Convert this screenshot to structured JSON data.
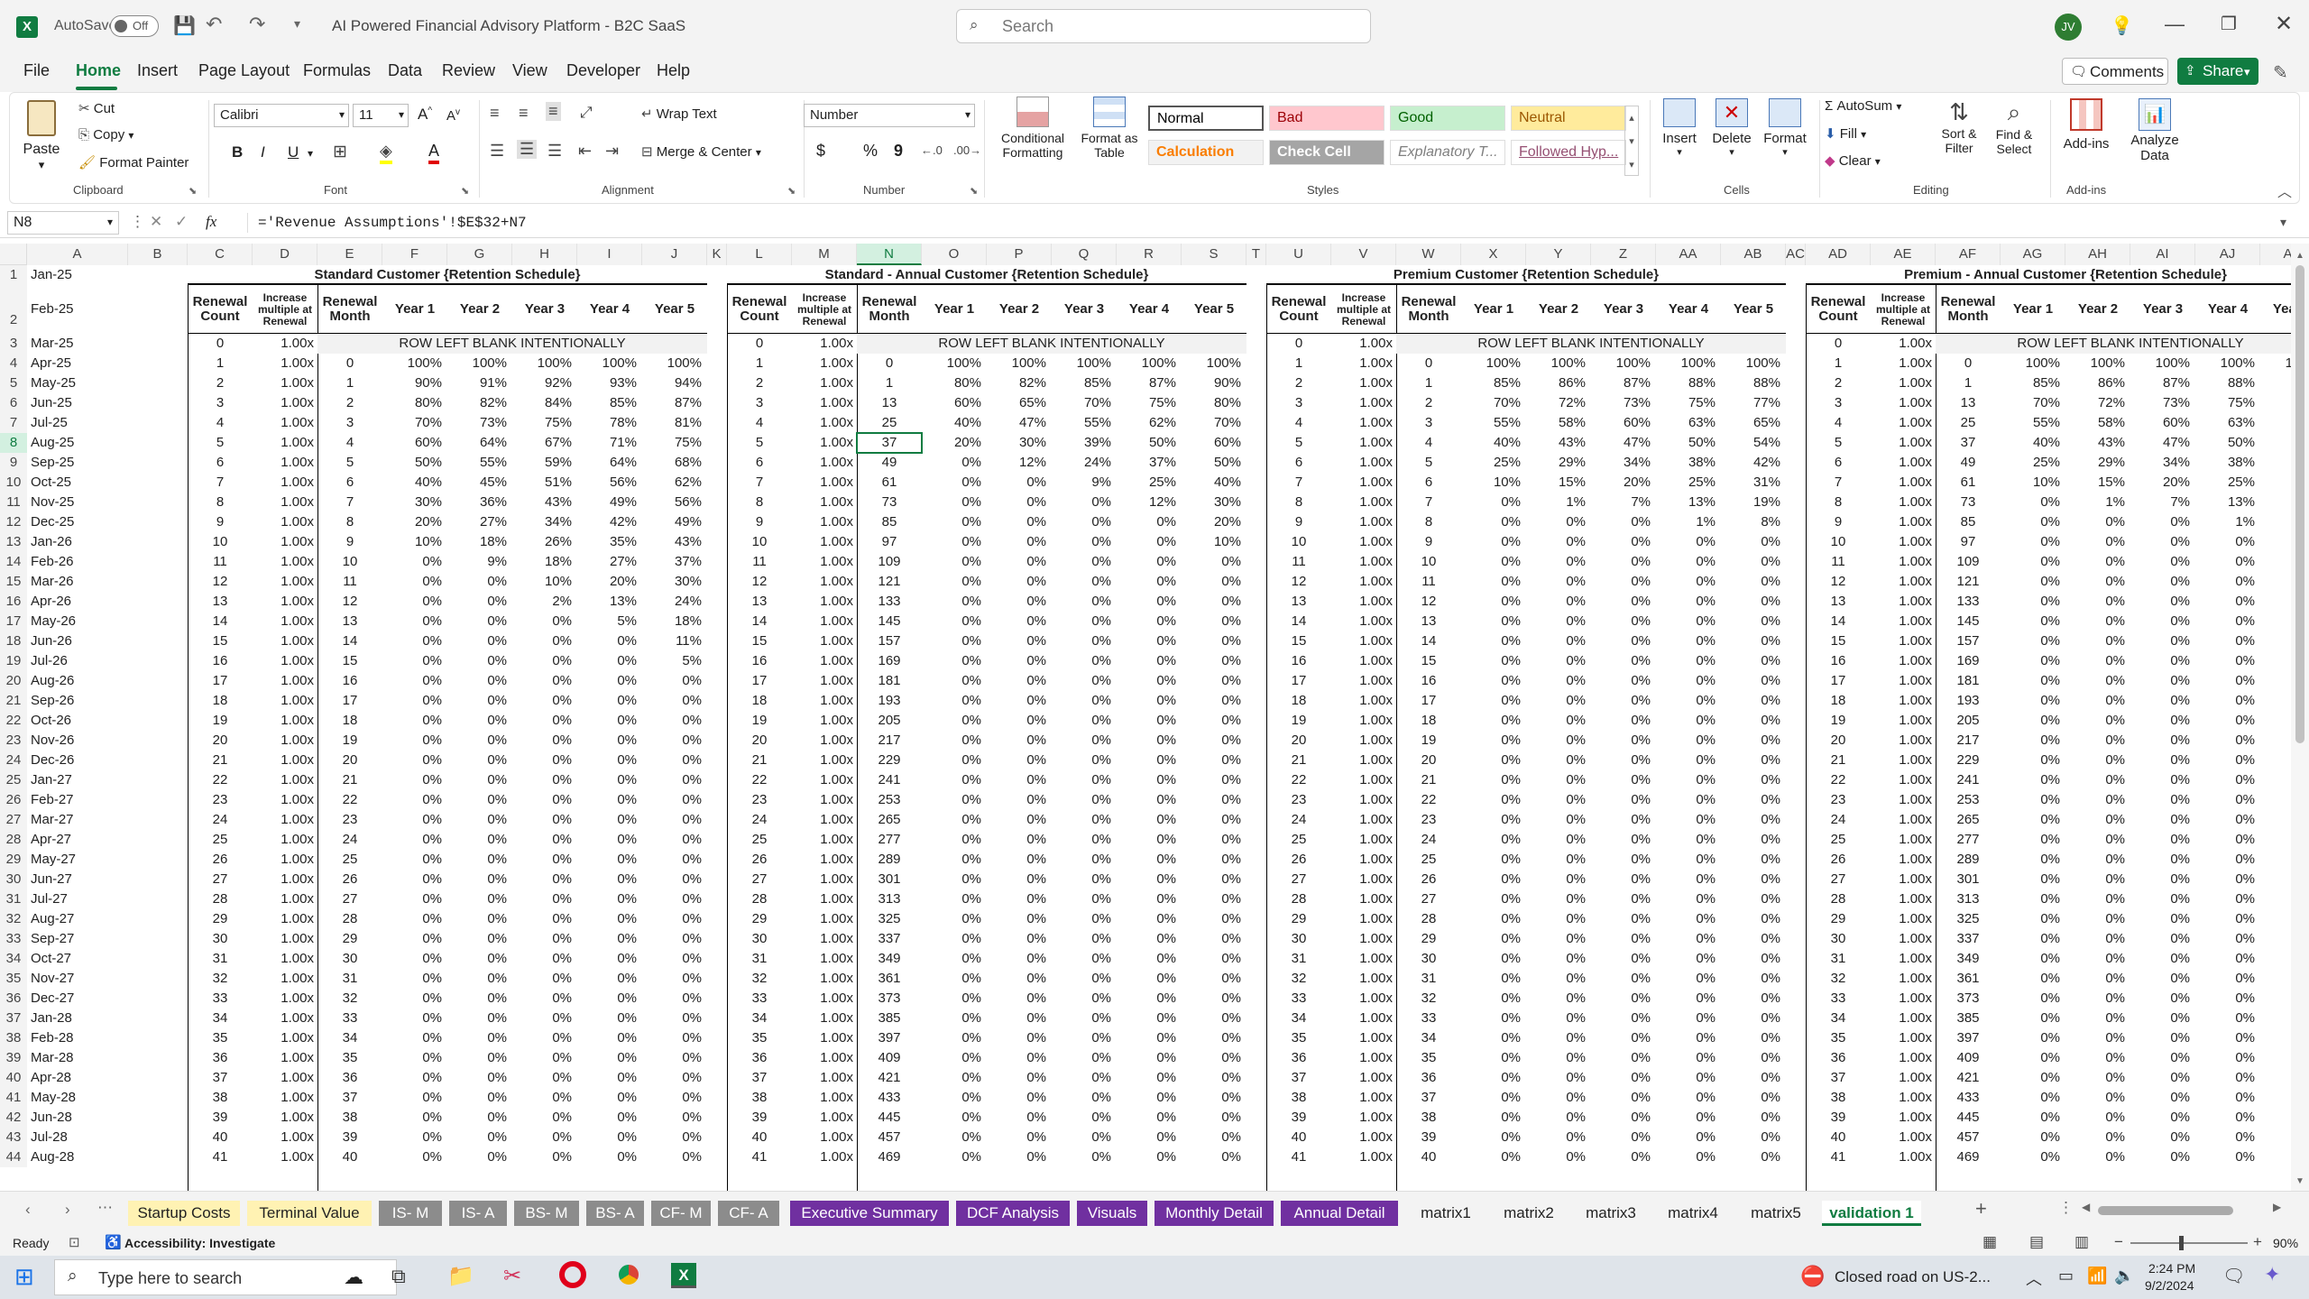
{
  "titlebar": {
    "autosave_label": "AutoSave",
    "autosave_state": "Off",
    "doc_title": "AI Powered Financial Advisory Platform - B2C SaaS",
    "search_placeholder": "Search",
    "user_initials": "JV"
  },
  "menu": {
    "tabs": [
      "File",
      "Home",
      "Insert",
      "Page Layout",
      "Formulas",
      "Data",
      "Review",
      "View",
      "Developer",
      "Help"
    ],
    "active": "Home",
    "comments": "Comments",
    "share": "Share"
  },
  "ribbon": {
    "clipboard": {
      "paste": "Paste",
      "cut": "Cut",
      "copy": "Copy",
      "format_painter": "Format Painter",
      "label": "Clipboard"
    },
    "font": {
      "name": "Calibri",
      "size": "11",
      "label": "Font",
      "bold": "B",
      "italic": "I",
      "underline": "U"
    },
    "alignment": {
      "wrap": "Wrap Text",
      "merge": "Merge & Center",
      "label": "Alignment"
    },
    "number": {
      "format": "Number",
      "label": "Number",
      "currency": "$",
      "percent": "%",
      "comma": "9"
    },
    "styles": {
      "conditional": "Conditional Formatting",
      "format_table": "Format as Table",
      "cells": [
        {
          "name": "Normal",
          "bg": "#ffffff",
          "fg": "#000000"
        },
        {
          "name": "Bad",
          "bg": "#ffc7ce",
          "fg": "#9c0006"
        },
        {
          "name": "Good",
          "bg": "#c6efce",
          "fg": "#006100"
        },
        {
          "name": "Neutral",
          "bg": "#ffeb9c",
          "fg": "#9c5700"
        },
        {
          "name": "Calculation",
          "bg": "#f2f2f2",
          "fg": "#fa7d00"
        },
        {
          "name": "Check Cell",
          "bg": "#a5a5a5",
          "fg": "#ffffff"
        },
        {
          "name": "Explanatory T...",
          "bg": "#ffffff",
          "fg": "#7f7f7f"
        },
        {
          "name": "Followed Hyp...",
          "bg": "#ffffff",
          "fg": "#954f72"
        }
      ],
      "label": "Styles"
    },
    "cells": {
      "insert": "Insert",
      "delete": "Delete",
      "format": "Format",
      "label": "Cells"
    },
    "editing": {
      "autosum": "AutoSum",
      "fill": "Fill",
      "clear": "Clear",
      "sort": "Sort & Filter",
      "find": "Find & Select",
      "label": "Editing"
    },
    "addins": {
      "addins": "Add-ins",
      "analyze": "Analyze Data",
      "label": "Add-ins"
    }
  },
  "formula_bar": {
    "name_box": "N8",
    "fx": "fx",
    "formula": "='Revenue Assumptions'!$E$32+N7"
  },
  "sheet": {
    "columns": [
      "A",
      "B",
      "C",
      "D",
      "E",
      "F",
      "G",
      "H",
      "I",
      "J",
      "K",
      "L",
      "M",
      "N",
      "O",
      "P",
      "Q",
      "R",
      "S",
      "T",
      "U",
      "V",
      "W",
      "X",
      "Y",
      "Z",
      "AA",
      "AB",
      "AC",
      "AD",
      "AE",
      "AF",
      "AG",
      "AH",
      "AI",
      "AJ",
      "AK"
    ],
    "rows": [
      1,
      2,
      3,
      4,
      5,
      6,
      7,
      8,
      9,
      10,
      11,
      12,
      13,
      14,
      15,
      16,
      17,
      18,
      19,
      20,
      21,
      22,
      23,
      24,
      25,
      26,
      27,
      28,
      29,
      30,
      31,
      32,
      33,
      34,
      35,
      36,
      37,
      38,
      39,
      40,
      41,
      42,
      43,
      44
    ],
    "dates": [
      "Jan-25",
      "Feb-25",
      "Mar-25",
      "Apr-25",
      "May-25",
      "Jun-25",
      "Jul-25",
      "Aug-25",
      "Sep-25",
      "Oct-25",
      "Nov-25",
      "Dec-25",
      "Jan-26",
      "Feb-26",
      "Mar-26",
      "Apr-26",
      "May-26",
      "Jun-26",
      "Jul-26",
      "Aug-26",
      "Sep-26",
      "Oct-26",
      "Nov-26",
      "Dec-26",
      "Jan-27",
      "Feb-27",
      "Mar-27",
      "Apr-27",
      "May-27",
      "Jun-27",
      "Jul-27",
      "Aug-27",
      "Sep-27",
      "Oct-27",
      "Nov-27",
      "Dec-27",
      "Jan-28",
      "Feb-28",
      "Mar-28",
      "Apr-28",
      "May-28",
      "Jun-28",
      "Jul-28",
      "Aug-28"
    ],
    "blank_text": "ROW LEFT BLANK INTENTIONALLY",
    "sub_headers": [
      "Renewal Count",
      "Increase multiple at Renewal",
      "Renewal Month",
      "Year 1",
      "Year 2",
      "Year 3",
      "Year 4",
      "Year 5"
    ],
    "blocks": [
      {
        "title": "Standard Customer {Retention Schedule}",
        "months": "seq",
        "pcts": [
          [
            100,
            100,
            100,
            100,
            100
          ],
          [
            90,
            91,
            92,
            93,
            94
          ],
          [
            80,
            82,
            84,
            85,
            87
          ],
          [
            70,
            73,
            75,
            78,
            81
          ],
          [
            60,
            64,
            67,
            71,
            75
          ],
          [
            50,
            55,
            59,
            64,
            68
          ],
          [
            40,
            45,
            51,
            56,
            62
          ],
          [
            30,
            36,
            43,
            49,
            56
          ],
          [
            20,
            27,
            34,
            42,
            49
          ],
          [
            10,
            18,
            26,
            35,
            43
          ],
          [
            0,
            9,
            18,
            27,
            37
          ],
          [
            0,
            0,
            10,
            20,
            30
          ],
          [
            0,
            0,
            2,
            13,
            24
          ],
          [
            0,
            0,
            0,
            5,
            18
          ],
          [
            0,
            0,
            0,
            0,
            11
          ],
          [
            0,
            0,
            0,
            0,
            5
          ]
        ]
      },
      {
        "title": "Standard - Annual Customer {Retention Schedule}",
        "months": "annual",
        "pcts": [
          [
            100,
            100,
            100,
            100,
            100
          ],
          [
            80,
            82,
            85,
            87,
            90
          ],
          [
            60,
            65,
            70,
            75,
            80
          ],
          [
            40,
            47,
            55,
            62,
            70
          ],
          [
            20,
            30,
            39,
            50,
            60
          ],
          [
            0,
            12,
            24,
            37,
            50
          ],
          [
            0,
            0,
            9,
            25,
            40
          ],
          [
            0,
            0,
            0,
            12,
            30
          ],
          [
            0,
            0,
            0,
            0,
            20
          ],
          [
            0,
            0,
            0,
            0,
            10
          ]
        ]
      },
      {
        "title": "Premium Customer {Retention Schedule}",
        "months": "seq",
        "pcts": [
          [
            100,
            100,
            100,
            100,
            100
          ],
          [
            85,
            86,
            87,
            88,
            88
          ],
          [
            70,
            72,
            73,
            75,
            77
          ],
          [
            55,
            58,
            60,
            63,
            65
          ],
          [
            40,
            43,
            47,
            50,
            54
          ],
          [
            25,
            29,
            34,
            38,
            42
          ],
          [
            10,
            15,
            20,
            25,
            31
          ],
          [
            0,
            1,
            7,
            13,
            19
          ],
          [
            0,
            0,
            0,
            1,
            8
          ]
        ]
      },
      {
        "title": "Premium - Annual Customer {Retention Schedule}",
        "months": "annual",
        "pcts": [
          [
            100,
            100,
            100,
            100,
            100
          ],
          [
            85,
            86,
            87,
            88,
            88
          ],
          [
            70,
            72,
            73,
            75,
            77
          ],
          [
            55,
            58,
            60,
            63,
            65
          ],
          [
            40,
            43,
            47,
            50,
            54
          ],
          [
            25,
            29,
            34,
            38,
            42
          ],
          [
            10,
            15,
            20,
            25,
            31
          ],
          [
            0,
            1,
            7,
            13,
            19
          ],
          [
            0,
            0,
            0,
            1,
            8
          ]
        ]
      }
    ],
    "multiple": "1.00x"
  },
  "tabs": [
    {
      "name": "Startup Costs",
      "color": "#fff2b3",
      "fg": "#222"
    },
    {
      "name": "Terminal Value",
      "color": "#fff2b3",
      "fg": "#222"
    },
    {
      "name": "IS- M",
      "color": "#8c8c8c",
      "fg": "#ffffff"
    },
    {
      "name": "IS- A",
      "color": "#8c8c8c",
      "fg": "#ffffff"
    },
    {
      "name": "BS- M",
      "color": "#8c8c8c",
      "fg": "#ffffff"
    },
    {
      "name": "BS- A",
      "color": "#8c8c8c",
      "fg": "#ffffff"
    },
    {
      "name": "CF- M",
      "color": "#8c8c8c",
      "fg": "#ffffff"
    },
    {
      "name": "CF- A",
      "color": "#8c8c8c",
      "fg": "#ffffff"
    },
    {
      "name": "Executive Summary",
      "color": "#7030a0",
      "fg": "#ffffff"
    },
    {
      "name": "DCF Analysis",
      "color": "#7030a0",
      "fg": "#ffffff"
    },
    {
      "name": "Visuals",
      "color": "#7030a0",
      "fg": "#ffffff"
    },
    {
      "name": "Monthly Detail",
      "color": "#7030a0",
      "fg": "#ffffff"
    },
    {
      "name": "Annual Detail",
      "color": "#7030a0",
      "fg": "#ffffff"
    },
    {
      "name": "matrix1",
      "color": "",
      "fg": "#222"
    },
    {
      "name": "matrix2",
      "color": "",
      "fg": "#222"
    },
    {
      "name": "matrix3",
      "color": "",
      "fg": "#222"
    },
    {
      "name": "matrix4",
      "color": "",
      "fg": "#222"
    },
    {
      "name": "matrix5",
      "color": "",
      "fg": "#222"
    },
    {
      "name": "validation 1",
      "color": "",
      "fg": "#107c41"
    }
  ],
  "status": {
    "ready": "Ready",
    "accessibility": "Accessibility: Investigate",
    "zoom": "90%"
  },
  "taskbar": {
    "search": "Type here to search",
    "notification": "Closed road on US-2...",
    "time": "2:24 PM",
    "date": "9/2/2024"
  }
}
